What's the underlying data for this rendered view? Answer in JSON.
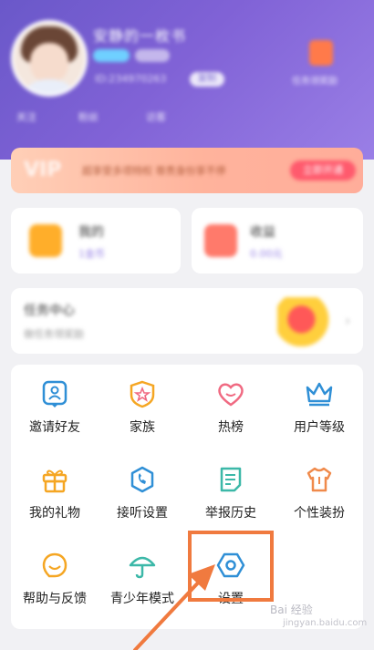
{
  "profile": {
    "name": "安静的一枚书",
    "id_text": "ID:234970263",
    "copy_label": "复制",
    "gift_label": "任务领奖励",
    "stats": [
      "关注",
      "粉丝",
      "访客"
    ]
  },
  "vip_banner": {
    "badge": "VIP",
    "text": "超享受多项特权 尊贵身份享不停",
    "button": "立即开通"
  },
  "cards": [
    {
      "title": "我的",
      "subtitle": "1金币"
    },
    {
      "title": "收益",
      "subtitle": "0.00元"
    }
  ],
  "task_center": {
    "title": "任务中心",
    "subtitle": "做任务领奖励"
  },
  "menu": [
    {
      "label": "邀请好友",
      "icon": "invite-icon"
    },
    {
      "label": "家族",
      "icon": "family-icon"
    },
    {
      "label": "热榜",
      "icon": "heart-icon"
    },
    {
      "label": "用户等级",
      "icon": "crown-icon"
    },
    {
      "label": "我的礼物",
      "icon": "gift-icon"
    },
    {
      "label": "接听设置",
      "icon": "phone-icon"
    },
    {
      "label": "举报历史",
      "icon": "report-icon"
    },
    {
      "label": "个性装扮",
      "icon": "shirt-icon"
    },
    {
      "label": "帮助与反馈",
      "icon": "help-icon"
    },
    {
      "label": "青少年模式",
      "icon": "umbrella-icon"
    },
    {
      "label": "设置",
      "icon": "settings-icon"
    }
  ],
  "watermark": {
    "line1": "Bai 经验",
    "line2": "jingyan.baidu.com"
  },
  "colors": {
    "accent_blue": "#2f8fd6",
    "accent_orange": "#f5a623",
    "accent_red": "#f06a82",
    "highlight": "#f07a3f"
  }
}
